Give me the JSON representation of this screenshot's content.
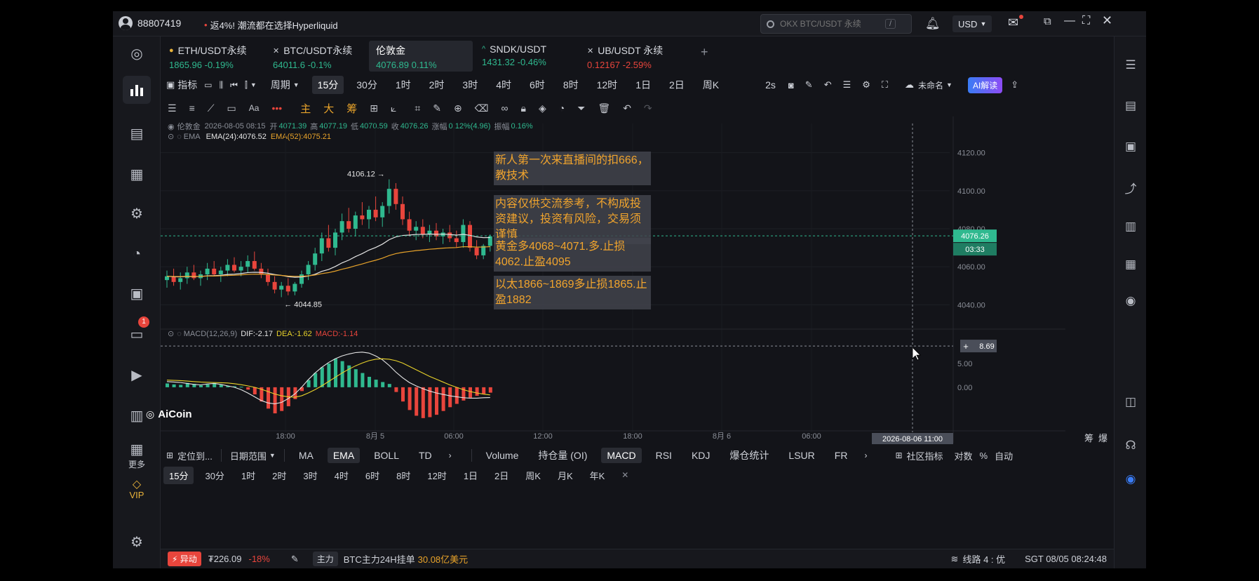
{
  "topbar": {
    "user_id": "88807419",
    "promo_prefix": "•",
    "promo_text": "返4%! 潮流都在选择Hyperliquid",
    "search_placeholder": "OKX BTC/USDT 永续",
    "search_shortcut": "/",
    "currency": "USD"
  },
  "leftnav": {
    "more_label": "更多",
    "vip_label": "VIP",
    "badge_count": "1"
  },
  "tabs": [
    {
      "name": "ETH/USDT永续",
      "price": "1865.96",
      "change": "-0.19%",
      "marker": "●",
      "color": "green"
    },
    {
      "name": "BTC/USDT永续",
      "price": "64011.6",
      "change": "-0.1%",
      "marker": "✕",
      "color": "green"
    },
    {
      "name": "伦敦金",
      "price": "4076.89",
      "change": "0.11%",
      "marker": "",
      "color": "green"
    },
    {
      "name": "SNDK/USDT",
      "price": "1431.32",
      "change": "-0.46%",
      "marker": "^",
      "color": "green"
    },
    {
      "name": "UB/USDT 永续",
      "price": "0.12167",
      "change": "-2.59%",
      "marker": "✕",
      "color": "red"
    }
  ],
  "toolbar1": {
    "indicator_label": "指标",
    "period_label": "周期",
    "periods": [
      "15分",
      "30分",
      "1时",
      "2时",
      "3时",
      "4时",
      "6时",
      "8时",
      "12时",
      "1日",
      "2日",
      "周K"
    ],
    "selected_period": "15分",
    "refresh": "2s",
    "layout_name": "未命名",
    "ai_label": "AI解读"
  },
  "toolbar2": {
    "main_label": "主",
    "big_label": "大",
    "chip_label": "筹"
  },
  "info_line": {
    "symbol": "伦敦金",
    "datetime": "2026-08-05 08:15",
    "open_label": "开",
    "open": "4071.39",
    "high_label": "高",
    "high": "4077.19",
    "low_label": "低",
    "low": "4070.59",
    "close_label": "收",
    "close": "4076.26",
    "change_label": "涨幅",
    "change": "0.12%(4.96)",
    "amp_label": "振幅",
    "amp": "0.16%"
  },
  "ema_line": {
    "label": "EMA",
    "ema24": "EMA(24):4076.52",
    "ema52": "EMA(52):4075.21"
  },
  "macd_line": {
    "label": "MACD(12,26,9)",
    "dif": "DIF:-2.17",
    "dea": "DEA:-1.62",
    "macd": "MACD:-1.14"
  },
  "notes": [
    "新人第一次来直播间的扣666，教技术",
    "内容仅供交流参考，不构成投资建议，投资有风险，交易须谨慎",
    "黄金多4068~4071.多.止损4062.止盈4095",
    "以太1866~1869多止损1865.止盈1882"
  ],
  "chart_data": {
    "type": "candlestick",
    "symbol": "伦敦金",
    "interval": "15分",
    "high_marker": "4106.12",
    "low_marker": "4044.85",
    "last_price": "4076.26",
    "countdown": "03:33",
    "crosshair_value": "8.69",
    "crosshair_time": "2026-08-06 11:00",
    "y_ticks": [
      "4120.00",
      "4100.00",
      "4080.00",
      "4060.00",
      "4040.00"
    ],
    "macd_ticks": [
      "5.00",
      "0.00"
    ],
    "x_ticks": [
      "18:00",
      "8月 5",
      "06:00",
      "12:00",
      "18:00",
      "8月 6",
      "06:00"
    ],
    "ylim": [
      4032,
      4128
    ],
    "candles": [
      [
        4053,
        4058,
        4049,
        4055
      ],
      [
        4055,
        4059,
        4050,
        4052
      ],
      [
        4052,
        4057,
        4048,
        4054
      ],
      [
        4054,
        4060,
        4051,
        4057
      ],
      [
        4057,
        4061,
        4053,
        4054
      ],
      [
        4054,
        4058,
        4050,
        4056
      ],
      [
        4056,
        4062,
        4053,
        4059
      ],
      [
        4059,
        4063,
        4055,
        4056
      ],
      [
        4056,
        4060,
        4052,
        4058
      ],
      [
        4058,
        4064,
        4055,
        4061
      ],
      [
        4061,
        4065,
        4057,
        4058
      ],
      [
        4058,
        4063,
        4055,
        4060
      ],
      [
        4060,
        4066,
        4057,
        4063
      ],
      [
        4063,
        4068,
        4058,
        4059
      ],
      [
        4059,
        4062,
        4054,
        4056
      ],
      [
        4056,
        4059,
        4050,
        4052
      ],
      [
        4052,
        4055,
        4046,
        4048
      ],
      [
        4048,
        4052,
        4044,
        4050
      ],
      [
        4050,
        4054,
        4045,
        4047
      ],
      [
        4047,
        4052,
        4045,
        4051
      ],
      [
        4051,
        4058,
        4049,
        4056
      ],
      [
        4056,
        4063,
        4053,
        4061
      ],
      [
        4061,
        4070,
        4058,
        4067
      ],
      [
        4067,
        4078,
        4063,
        4075
      ],
      [
        4075,
        4082,
        4068,
        4070
      ],
      [
        4070,
        4080,
        4066,
        4078
      ],
      [
        4078,
        4088,
        4074,
        4084
      ],
      [
        4084,
        4091,
        4078,
        4080
      ],
      [
        4080,
        4089,
        4076,
        4087
      ],
      [
        4087,
        4094,
        4082,
        4085
      ],
      [
        4085,
        4092,
        4080,
        4090
      ],
      [
        4090,
        4097,
        4084,
        4086
      ],
      [
        4086,
        4094,
        4081,
        4092
      ],
      [
        4092,
        4106,
        4088,
        4101
      ],
      [
        4101,
        4104,
        4090,
        4093
      ],
      [
        4093,
        4097,
        4082,
        4085
      ],
      [
        4085,
        4089,
        4076,
        4079
      ],
      [
        4079,
        4084,
        4074,
        4081
      ],
      [
        4081,
        4085,
        4075,
        4077
      ],
      [
        4077,
        4082,
        4073,
        4079
      ],
      [
        4079,
        4083,
        4074,
        4076
      ],
      [
        4076,
        4080,
        4072,
        4078
      ],
      [
        4078,
        4082,
        4073,
        4075
      ],
      [
        4075,
        4079,
        4070,
        4073
      ],
      [
        4073,
        4085,
        4070,
        4082
      ],
      [
        4082,
        4084,
        4068,
        4070
      ],
      [
        4070,
        4074,
        4064,
        4066
      ],
      [
        4066,
        4072,
        4064,
        4071
      ],
      [
        4071,
        4077,
        4068,
        4076
      ]
    ],
    "macd_hist": [
      0.8,
      0.6,
      0.5,
      0.9,
      0.7,
      0.4,
      0.6,
      0.9,
      0.5,
      0.3,
      0.2,
      0.1,
      -0.5,
      -1.5,
      -3,
      -4.5,
      -5.5,
      -5,
      -4,
      -2.5,
      -0.8,
      1.5,
      3,
      4.2,
      5,
      6,
      5.5,
      4.6,
      3.8,
      3,
      2.2,
      1.6,
      1.1,
      0.7,
      -1,
      -3,
      -4.8,
      -6,
      -6.5,
      -6.3,
      -5.8,
      -5,
      -4.2,
      -3.5,
      -2.8,
      -2.2,
      -1.8,
      -1.4,
      -1.14
    ],
    "macd_dif": [
      1.2,
      1.1,
      1.0,
      0.8,
      0.6,
      0.5,
      0.7,
      0.8,
      0.6,
      0.3,
      0,
      -0.5,
      -1.2,
      -2,
      -2.8,
      -3.3,
      -3.5,
      -3.2,
      -2.4,
      -1.4,
      0,
      1.6,
      3,
      4.2,
      5.2,
      6,
      6.6,
      7,
      7.3,
      7.4,
      7.2,
      6.6,
      5.8,
      4.6,
      3.2,
      2,
      1,
      0.3,
      -0.3,
      -0.8,
      -1.2,
      -1.5,
      -1.8,
      -2,
      -2.2,
      -2.3,
      -2.3,
      -2.2,
      -2.17
    ],
    "macd_dea": [
      1.5,
      1.45,
      1.4,
      1.3,
      1.2,
      1.1,
      1.05,
      1.0,
      0.95,
      0.9,
      0.75,
      0.55,
      0.3,
      0,
      -0.4,
      -0.9,
      -1.4,
      -1.8,
      -2,
      -2.1,
      -1.8,
      -1.2,
      -0.5,
      0.3,
      1.2,
      2.1,
      3,
      3.8,
      4.5,
      5.1,
      5.6,
      5.9,
      6,
      5.9,
      5.6,
      5.1,
      4.4,
      3.7,
      3,
      2.3,
      1.7,
      1.1,
      0.5,
      0,
      -0.5,
      -0.9,
      -1.2,
      -1.45,
      -1.62
    ]
  },
  "bottom_indicators": {
    "locate_label": "定位到...",
    "range_label": "日期范围",
    "main_inds": [
      "MA",
      "EMA",
      "BOLL",
      "TD"
    ],
    "selected_main": "EMA",
    "sub_inds": [
      "Volume",
      "持仓量 (OI)",
      "MACD",
      "RSI",
      "KDJ",
      "爆仓统计",
      "LSUR",
      "FR"
    ],
    "selected_sub": "MACD",
    "community_label": "社区指标",
    "log_label": "对数",
    "pct_label": "%",
    "auto_label": "自动"
  },
  "bottom_periods": {
    "periods": [
      "15分",
      "30分",
      "1时",
      "2时",
      "3时",
      "4时",
      "6时",
      "8时",
      "12时",
      "1日",
      "2日",
      "周K",
      "月K",
      "年K"
    ],
    "selected": "15分"
  },
  "statusbar": {
    "alert_label": "异动",
    "ticker_price": "₮226.09",
    "ticker_change": "-18%",
    "main_label": "主力",
    "main_text": "BTC主力24H挂单",
    "main_value": "30.08亿美元",
    "line_label": "线路 4 : 优",
    "time": "SGT 08/05 08:24:48"
  },
  "logo": "AiCoin",
  "right_labels": {
    "chip": "筹",
    "burst": "爆"
  },
  "colors": {
    "up": "#2fb98f",
    "down": "#e8453c",
    "ema24": "#e6e6e6",
    "ema52": "#e8a32a",
    "accent": "#3a7cf5",
    "note_text": "#f1a42d"
  }
}
